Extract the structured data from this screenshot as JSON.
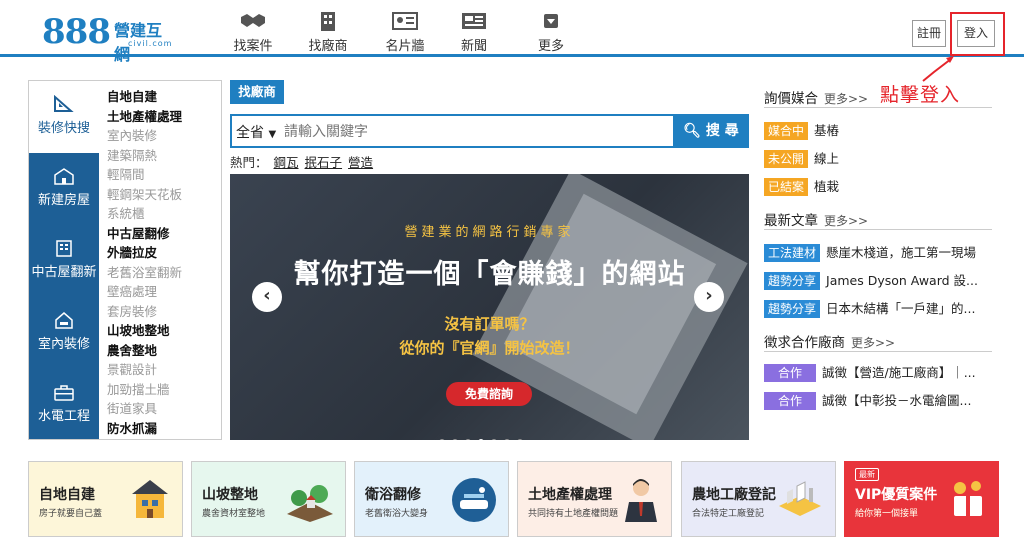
{
  "header": {
    "logo_number": "888",
    "logo_brand": "營建互網",
    "logo_domain": "civil.com",
    "nav": [
      {
        "label": "找案件",
        "icon": "handshake-icon"
      },
      {
        "label": "找廠商",
        "icon": "building-icon"
      },
      {
        "label": "名片牆",
        "icon": "id-card-icon"
      },
      {
        "label": "新聞",
        "icon": "news-icon"
      },
      {
        "label": "更多",
        "icon": "dropdown-box-icon"
      }
    ],
    "register_label": "註冊",
    "login_label": "登入"
  },
  "annotation": {
    "callout_text": "點擊登入",
    "highlight_color": "#e5242b"
  },
  "sidebar": {
    "tabs": [
      {
        "label": "裝修快搜",
        "icon": "ruler-triangle-icon"
      },
      {
        "label": "新建房屋",
        "icon": "house-icon"
      },
      {
        "label": "中古屋翻新",
        "icon": "apartment-icon"
      },
      {
        "label": "室內裝修",
        "icon": "interior-icon"
      },
      {
        "label": "水電工程",
        "icon": "toolbox-icon"
      }
    ],
    "items": [
      {
        "label": "自地自建",
        "style": "bold"
      },
      {
        "label": "土地產權處理",
        "style": "bold"
      },
      {
        "label": "室內裝修",
        "style": "gray"
      },
      {
        "label": "建築隔熱",
        "style": "gray"
      },
      {
        "label": "輕隔間",
        "style": "gray"
      },
      {
        "label": "輕鋼架天花板",
        "style": "gray"
      },
      {
        "label": "系統櫃",
        "style": "gray"
      },
      {
        "label": "中古屋翻修",
        "style": "bold"
      },
      {
        "label": "外牆拉皮",
        "style": "bold"
      },
      {
        "label": "老舊浴室翻新",
        "style": "gray"
      },
      {
        "label": "壁癌處理",
        "style": "gray"
      },
      {
        "label": "套房裝修",
        "style": "gray"
      },
      {
        "label": "山坡地整地",
        "style": "bold"
      },
      {
        "label": "農舍整地",
        "style": "bold"
      },
      {
        "label": "景觀設計",
        "style": "gray"
      },
      {
        "label": "加勁擋土牆",
        "style": "gray"
      },
      {
        "label": "街道家具",
        "style": "gray"
      },
      {
        "label": "防水抓漏",
        "style": "bold"
      }
    ]
  },
  "search": {
    "tab_label": "找廠商",
    "select_value": "全省",
    "placeholder": "請輸入關鍵字",
    "button_label": "搜 尋",
    "hot_label": "熱門：",
    "hot_keywords": [
      "鋼瓦",
      "抿石子",
      "營造"
    ]
  },
  "banner": {
    "tagline": "營建業的網路行銷專家",
    "headline": "幫你打造一個「會賺錢」的網站",
    "sub1": "沒有訂單嗎？",
    "sub2": "從你的『官網』開始改造！",
    "cta_label": "免費諮詢",
    "prev_label": "‹",
    "next_label": "›",
    "dot_count": 7,
    "active_dot": 3
  },
  "right": {
    "matching": {
      "title": "詢價媒合",
      "more": "更多>>",
      "rows": [
        {
          "tag": "媒合中",
          "text": "基樁"
        },
        {
          "tag": "未公開",
          "text": "線上"
        },
        {
          "tag": "已結案",
          "text": "植栽"
        }
      ]
    },
    "articles": {
      "title": "最新文章",
      "more": "更多>>",
      "rows": [
        {
          "tag": "工法建材",
          "text": "懸崖木棧道，施工第一現場"
        },
        {
          "tag": "趨勢分享",
          "text": "James Dyson Award 設..."
        },
        {
          "tag": "趨勢分享",
          "text": "日本木結構「一戶建」的..."
        }
      ]
    },
    "partners": {
      "title": "徵求合作廠商",
      "more": "更多>>",
      "rows": [
        {
          "tag": "合作",
          "text": "誠徵【營造/施工廠商】｜..."
        },
        {
          "tag": "合作",
          "text": "誠徵【中彰投－水電繪圖..."
        }
      ]
    }
  },
  "cards": [
    {
      "title": "自地自建",
      "subtitle": "房子就要自己蓋",
      "bg": "#fdf6d9",
      "icon": "house-build-icon"
    },
    {
      "title": "山坡整地",
      "subtitle": "農舍資材室整地",
      "bg": "#e6f7ee",
      "icon": "hillside-icon"
    },
    {
      "title": "衛浴翻修",
      "subtitle": "老舊衛浴大變身",
      "bg": "#e3f1fb",
      "icon": "bathtub-icon"
    },
    {
      "title": "土地產權處理",
      "subtitle": "共同持有土地產權問題",
      "bg": "#fdeee6",
      "icon": "lawyer-icon"
    },
    {
      "title": "農地工廠登記",
      "subtitle": "合法特定工廠登記",
      "bg": "#e8eaf8",
      "icon": "factory-icon"
    },
    {
      "title": "VIP優質案件",
      "subtitle": "給你第一個接單",
      "badge": "最新",
      "bg": "#e8343b",
      "icon": "gift-icon"
    }
  ]
}
